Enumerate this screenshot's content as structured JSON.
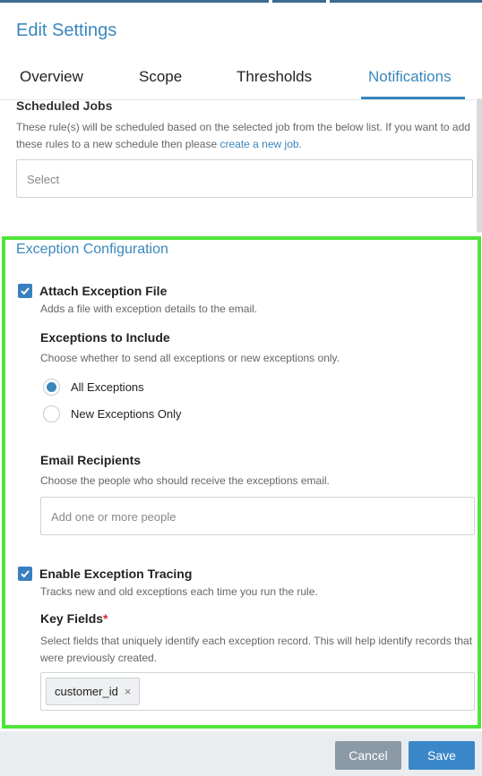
{
  "dialog": {
    "title": "Edit Settings"
  },
  "tabs": [
    {
      "label": "Overview"
    },
    {
      "label": "Scope"
    },
    {
      "label": "Thresholds"
    },
    {
      "label": "Notifications"
    }
  ],
  "scheduled_jobs": {
    "title": "Scheduled Jobs",
    "description": "These rule(s) will be scheduled based on the selected job from the below list. If you want to add these rules to a new schedule then please ",
    "link_text": "create a new job",
    "description_end": ".",
    "select_placeholder": "Select"
  },
  "exception_config": {
    "title": "Exception Configuration",
    "attach": {
      "label": "Attach Exception File",
      "description": "Adds a file with exception details to the email.",
      "checked": true
    },
    "include": {
      "title": "Exceptions to Include",
      "description": "Choose whether to send all exceptions or new exceptions only.",
      "options": [
        {
          "label": "All Exceptions",
          "selected": true
        },
        {
          "label": "New Exceptions Only",
          "selected": false
        }
      ]
    },
    "recipients": {
      "title": "Email Recipients",
      "description": "Choose the people who should receive the exceptions email.",
      "placeholder": "Add one or more people"
    },
    "tracing": {
      "label": "Enable Exception Tracing",
      "description": "Tracks new and old exceptions each time you run the rule.",
      "checked": true
    },
    "key_fields": {
      "title": "Key Fields",
      "required_mark": "*",
      "description": "Select fields that uniquely identify each exception record. This will help identify records that were previously created.",
      "tags": [
        "customer_id"
      ],
      "remove_glyph": "×"
    }
  },
  "footer": {
    "cancel_label": "Cancel",
    "save_label": "Save"
  },
  "colors": {
    "accent": "#3a87bd",
    "highlight": "#4fe43a",
    "cancel": "#8b9aa7",
    "save": "#3a87c9"
  }
}
